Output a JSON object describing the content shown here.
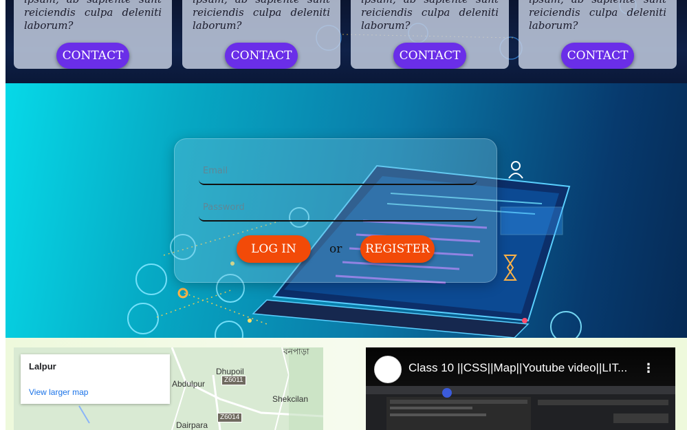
{
  "cards": {
    "body_text": "ipsum, ab sapiente sunt reiciendis culpa deleniti laborum?",
    "contact_label": "CONTACT",
    "count": 4
  },
  "login": {
    "email_placeholder": "Email",
    "password_placeholder": "Password",
    "login_label": "LOG IN",
    "or_text": "or",
    "register_label": "REGISTER"
  },
  "map": {
    "place_name": "Lalpur",
    "view_larger_label": "View larger map",
    "labels": {
      "dhupoil": "Dhupoil",
      "abdulpur": "Abdulpur",
      "shekcilan": "Shekcilan",
      "dairpara": "Dairpara",
      "bonpara": "বনপাড়া"
    },
    "roads": {
      "z6011": "Z6011",
      "z6014": "Z6014"
    }
  },
  "video": {
    "title": "Class 10 ||CSS||Map||Youtube video||LIT...",
    "menu_icon": "⋮"
  },
  "colors": {
    "contact_button": "#6a2ee8",
    "orange_button": "#f24a08",
    "map_link": "#1a73e8"
  }
}
